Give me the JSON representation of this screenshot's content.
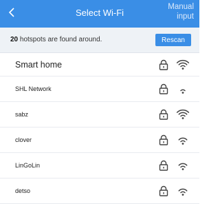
{
  "header": {
    "title": "Select Wi-Fi",
    "manual_line1": "Manual",
    "manual_line2": "input"
  },
  "info": {
    "count": "20",
    "text": " hotspots are found around.",
    "rescan_label": "Rescan"
  },
  "networks": [
    {
      "name": "Smart home",
      "locked": true,
      "signal": 3
    },
    {
      "name": "SHL Network",
      "locked": true,
      "signal": 1
    },
    {
      "name": "sabz",
      "locked": true,
      "signal": 3
    },
    {
      "name": "clover",
      "locked": true,
      "signal": 2
    },
    {
      "name": "LinGoLin",
      "locked": true,
      "signal": 2
    },
    {
      "name": "detso",
      "locked": true,
      "signal": 2
    }
  ],
  "colors": {
    "accent": "#3a8ee6"
  }
}
